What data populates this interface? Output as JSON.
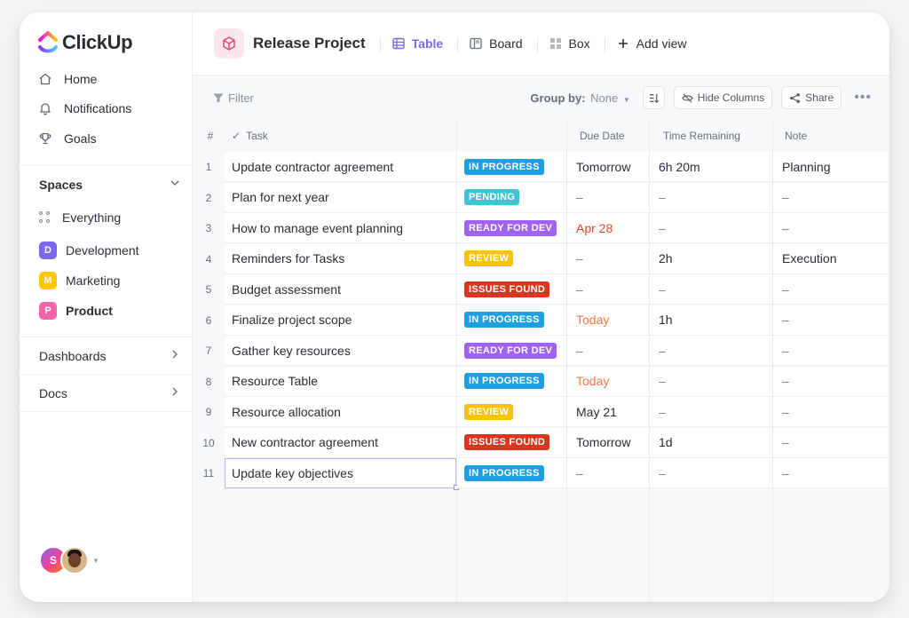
{
  "app": {
    "name": "ClickUp"
  },
  "sidebar": {
    "nav": [
      {
        "label": "Home",
        "icon": "home-icon"
      },
      {
        "label": "Notifications",
        "icon": "bell-icon"
      },
      {
        "label": "Goals",
        "icon": "trophy-icon"
      }
    ],
    "spaces_header": "Spaces",
    "everything_label": "Everything",
    "spaces": [
      {
        "letter": "D",
        "label": "Development",
        "color": "#7b68ee"
      },
      {
        "letter": "M",
        "label": "Marketing",
        "color": "#ffc800"
      },
      {
        "letter": "P",
        "label": "Product",
        "color": "#f564a9"
      }
    ],
    "dashboards_label": "Dashboards",
    "docs_label": "Docs",
    "user_initial": "S"
  },
  "header": {
    "project_title": "Release Project",
    "views": [
      {
        "label": "Table",
        "icon": "table-icon",
        "active": true
      },
      {
        "label": "Board",
        "icon": "board-icon",
        "active": false
      },
      {
        "label": "Box",
        "icon": "box-icon",
        "active": false
      }
    ],
    "add_view_label": "Add view"
  },
  "toolbar": {
    "filter_label": "Filter",
    "group_by_label": "Group by:",
    "group_by_value": "None",
    "hide_columns_label": "Hide Columns",
    "share_label": "Share"
  },
  "table": {
    "columns": {
      "num": "#",
      "task": "Task",
      "due": "Due Date",
      "time": "Time Remaining",
      "note": "Note"
    },
    "status_colors": {
      "IN PROGRESS": "#1f9fe3",
      "PENDING": "#3dc5d4",
      "READY FOR DEV": "#a062f2",
      "REVIEW": "#f8c400",
      "ISSUES FOUND": "#d9361f"
    },
    "rows": [
      {
        "n": "1",
        "task": "Update contractor agreement",
        "status": "IN PROGRESS",
        "due": "Tomorrow",
        "due_style": "normal",
        "time": "6h 20m",
        "note": "Planning"
      },
      {
        "n": "2",
        "task": "Plan for next year",
        "status": "PENDING",
        "due": "–",
        "due_style": "muted",
        "time": "–",
        "note": "–"
      },
      {
        "n": "3",
        "task": "How to manage event planning",
        "status": "READY FOR DEV",
        "due": "Apr 28",
        "due_style": "red",
        "time": "–",
        "note": "–"
      },
      {
        "n": "4",
        "task": "Reminders for Tasks",
        "status": "REVIEW",
        "due": "–",
        "due_style": "muted",
        "time": "2h",
        "note": "Execution"
      },
      {
        "n": "5",
        "task": "Budget assessment",
        "status": "ISSUES FOUND",
        "due": "–",
        "due_style": "muted",
        "time": "–",
        "note": "–"
      },
      {
        "n": "6",
        "task": "Finalize project scope",
        "status": "IN PROGRESS",
        "due": "Today",
        "due_style": "orange",
        "time": "1h",
        "note": "–"
      },
      {
        "n": "7",
        "task": "Gather key resources",
        "status": "READY FOR DEV",
        "due": "–",
        "due_style": "muted",
        "time": "–",
        "note": "–"
      },
      {
        "n": "8",
        "task": "Resource Table",
        "status": "IN PROGRESS",
        "due": "Today",
        "due_style": "orange",
        "time": "–",
        "note": "–"
      },
      {
        "n": "9",
        "task": "Resource allocation",
        "status": "REVIEW",
        "due": "May 21",
        "due_style": "normal",
        "time": "–",
        "note": "–"
      },
      {
        "n": "10",
        "task": "New contractor agreement",
        "status": "ISSUES FOUND",
        "due": "Tomorrow",
        "due_style": "normal",
        "time": "1d",
        "note": "–"
      },
      {
        "n": "11",
        "task": "Update key objectives",
        "status": "IN PROGRESS",
        "due": "–",
        "due_style": "muted",
        "time": "–",
        "note": "–"
      }
    ]
  }
}
